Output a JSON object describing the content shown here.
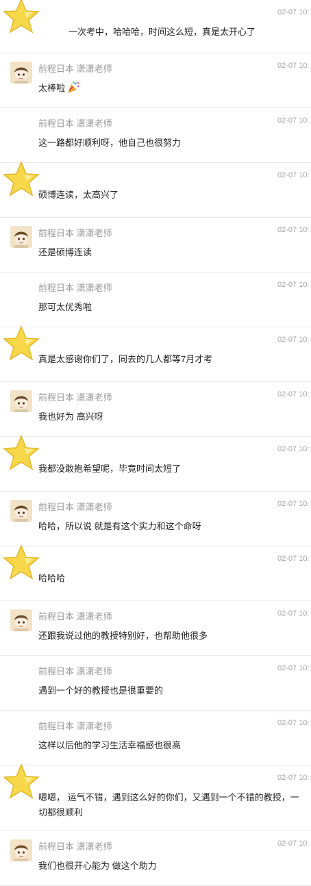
{
  "messages": [
    {
      "kind": "student",
      "name": "",
      "time": "02-07 10:",
      "text": "一次考中，哈哈哈，时间这么短，真是太开心了",
      "text_indent": true
    },
    {
      "kind": "teacher",
      "avatar": true,
      "name": "前程日本 潇潇老师",
      "time": "02-07 10:",
      "text": "太棒啦",
      "emoji": "party-popper-icon"
    },
    {
      "kind": "teacher",
      "avatar": false,
      "name": "前程日本 潇潇老师",
      "time": "02-07 10:",
      "text": "这一路都好顺利呀，他自己也很努力"
    },
    {
      "kind": "student",
      "name": "",
      "time": "02-07 10:",
      "text": "硕博连读，太高兴了"
    },
    {
      "kind": "teacher",
      "avatar": true,
      "name": "前程日本 潇潇老师",
      "time": "02-07 10:",
      "text": "还是硕博连读"
    },
    {
      "kind": "teacher",
      "avatar": false,
      "name": "前程日本 潇潇老师",
      "time": "02-07 10:",
      "text": "那可太优秀啦"
    },
    {
      "kind": "student",
      "name": "",
      "time": "02-07 10:",
      "text": "真是太感谢你们了，同去的几人都等7月才考"
    },
    {
      "kind": "teacher",
      "avatar": true,
      "name": "前程日本 潇潇老师",
      "time": "02-07 10:",
      "text": "我也好为      高兴呀"
    },
    {
      "kind": "student",
      "name": "",
      "time": "02-07 10:",
      "text": "我都没敢抱希望呢，毕竟时间太短了"
    },
    {
      "kind": "teacher",
      "avatar": true,
      "name": "前程日本 潇潇老师",
      "time": "02-07 10:",
      "text": "哈哈，所以说       就是有这个实力和这个命呀"
    },
    {
      "kind": "student",
      "name": "",
      "time": "02-07 10:",
      "text": "哈哈哈"
    },
    {
      "kind": "teacher",
      "avatar": true,
      "name": "前程日本 潇潇老师",
      "time": "02-07 10:",
      "text": "   还跟我说过他的教授特别好，也帮助他很多"
    },
    {
      "kind": "teacher",
      "avatar": false,
      "name": "前程日本 潇潇老师",
      "time": "02-07 10:",
      "text": "遇到一个好的教授也是很重要的"
    },
    {
      "kind": "teacher",
      "avatar": false,
      "name": "前程日本 潇潇老师",
      "time": "02-07 10:",
      "text": "这样以后他的学习生活幸福感也很高"
    },
    {
      "kind": "student",
      "name": "",
      "time": "02-07 10:",
      "text": "嗯嗯，       运气不错，遇到这么好的你们，又遇到一个不错的教授，一切都很顺利"
    },
    {
      "kind": "teacher",
      "avatar": true,
      "name": "前程日本 潇潇老师",
      "time": "02-07 10:",
      "text": "我们也很开心能为       做这个助力"
    }
  ],
  "colors": {
    "star_fill": "#f7d84a",
    "star_stroke": "#e0b72a",
    "avatar_bg": "#f3e3c6",
    "hair": "#6b4a2a",
    "divider": "#e9e9e9"
  }
}
